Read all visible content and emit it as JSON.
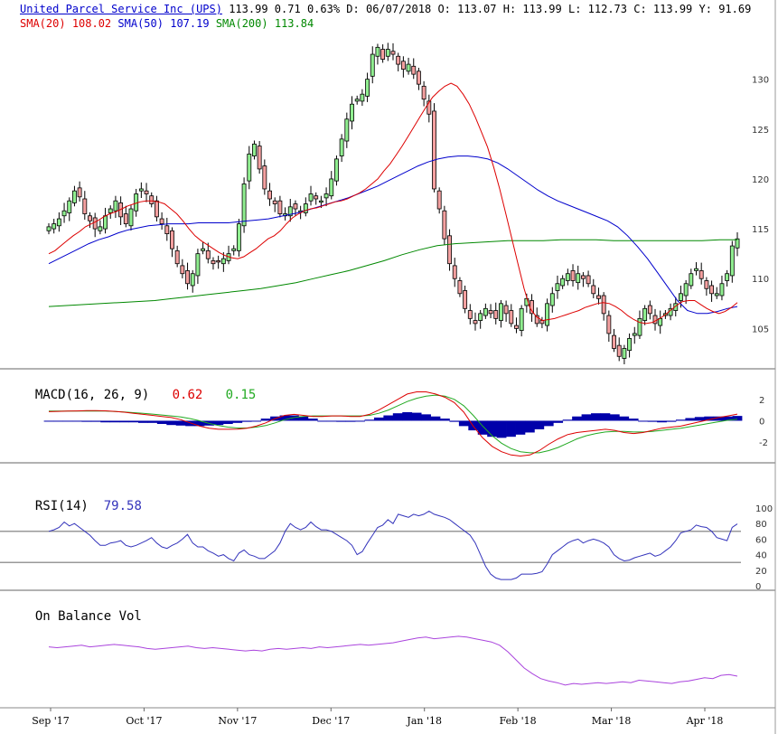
{
  "header": {
    "ticker_title": "United Parcel Service Inc (UPS)",
    "last": "113.99",
    "change": "0.71",
    "change_pct": "0.63%",
    "date_label": "D: 06/07/2018",
    "open_label": "O: 113.07",
    "high_label": "H: 113.99",
    "low_label": "L: 112.73",
    "close_label": "C: 113.99",
    "y_label": "Y:",
    "y_value": "91.69",
    "sma20_label": "SMA(20)",
    "sma20_value": "108.02",
    "sma50_label": "SMA(50)",
    "sma50_value": "107.19",
    "sma200_label": "SMA(200)",
    "sma200_value": "113.84"
  },
  "colors": {
    "sma20": "#dd0000",
    "sma50": "#0000cc",
    "sma200": "#008800",
    "up_candle": "#90ee90",
    "down_candle": "#f4a0a0",
    "macd_hist": "#0000aa",
    "rsi_line": "#3333bb",
    "obv_line": "#aa44dd"
  },
  "panels": {
    "macd": {
      "title": "MACD(16, 26, 9)",
      "macd_value": "0.62",
      "signal_value": "0.15"
    },
    "rsi": {
      "title": "RSI(14)",
      "value": "79.58"
    },
    "obv": {
      "title": "On Balance Vol"
    }
  },
  "chart_data": [
    {
      "type": "candlestick",
      "x_labels": [
        "Sep '17",
        "Oct '17",
        "Nov '17",
        "Dec '17",
        "Jan '18",
        "Feb '18",
        "Mar '18",
        "Apr '18"
      ],
      "y_ticks": [
        105,
        110,
        115,
        120,
        125,
        130
      ],
      "ylim": [
        101.5,
        134.5
      ],
      "close_path": [
        115.2,
        115.5,
        116.0,
        116.8,
        117.8,
        118.8,
        118.2,
        116.5,
        115.8,
        115.0,
        115.2,
        116.3,
        117.0,
        117.8,
        116.2,
        115.5,
        117.0,
        118.5,
        119.0,
        118.5,
        117.5,
        116.2,
        115.5,
        114.5,
        113.0,
        111.5,
        110.5,
        109.5,
        110.5,
        112.5,
        113.0,
        112.0,
        111.5,
        111.7,
        112.0,
        112.5,
        113.0,
        115.5,
        119.5,
        122.5,
        123.5,
        121.0,
        119.0,
        118.0,
        117.5,
        116.5,
        116.5,
        117.2,
        117.0,
        116.8,
        117.5,
        118.5,
        118.0,
        117.8,
        118.5,
        120.0,
        122.0,
        124.0,
        126.0,
        127.5,
        128.0,
        128.5,
        130.0,
        132.5,
        133.2,
        132.0,
        133.0,
        132.5,
        131.5,
        131.0,
        131.5,
        130.5,
        129.5,
        128.0,
        126.5,
        119.0,
        117.0,
        114.0,
        111.5,
        110.0,
        108.5,
        107.0,
        106.0,
        105.5,
        106.5,
        107.0,
        106.5,
        106.0,
        107.5,
        106.5,
        105.5,
        105.0,
        107.0,
        108.0,
        106.5,
        105.5,
        105.5,
        107.5,
        108.5,
        109.5,
        110.0,
        110.5,
        109.8,
        110.5,
        110.0,
        109.5,
        108.5,
        108.0,
        106.5,
        104.5,
        103.0,
        102.2,
        103.0,
        104.0,
        104.5,
        106.0,
        107.0,
        106.5,
        105.5,
        106.0,
        106.5,
        107.0,
        107.5,
        108.5,
        109.5,
        110.5,
        111.0,
        110.0,
        109.0,
        108.5,
        108.5,
        109.5,
        110.5,
        113.28,
        113.99
      ],
      "sma20_path": [
        112.5,
        112.8,
        113.3,
        113.8,
        114.3,
        114.7,
        115.2,
        115.5,
        115.8,
        116.2,
        116.5,
        116.7,
        117.0,
        117.3,
        117.5,
        117.7,
        117.8,
        117.8,
        117.7,
        117.5,
        117.0,
        116.5,
        115.8,
        115.0,
        114.3,
        113.8,
        113.4,
        113.0,
        112.6,
        112.3,
        112.1,
        112.0,
        112.2,
        112.6,
        113.0,
        113.5,
        114.0,
        114.3,
        114.8,
        115.5,
        116.1,
        116.5,
        116.8,
        117.0,
        117.1,
        117.3,
        117.5,
        117.7,
        117.8,
        118.0,
        118.3,
        118.6,
        119.0,
        119.5,
        120.0,
        120.8,
        121.5,
        122.4,
        123.3,
        124.3,
        125.3,
        126.3,
        127.3,
        128.2,
        128.8,
        129.3,
        129.6,
        129.3,
        128.5,
        127.5,
        126.2,
        124.7,
        123.2,
        121.2,
        119.0,
        116.5,
        114.0,
        111.5,
        109.0,
        107.0,
        106.2,
        105.8,
        105.9,
        106.0,
        106.2,
        106.4,
        106.6,
        106.8,
        107.1,
        107.3,
        107.5,
        107.6,
        107.5,
        107.2,
        106.8,
        106.3,
        105.9,
        105.6,
        105.5,
        105.6,
        105.9,
        106.3,
        106.8,
        107.3,
        107.7,
        107.8,
        107.8,
        107.4,
        107.0,
        106.7,
        106.5,
        106.7,
        107.1,
        107.6
      ],
      "sma50_path": [
        111.5,
        112.0,
        112.5,
        113.0,
        113.5,
        113.9,
        114.2,
        114.6,
        114.9,
        115.1,
        115.3,
        115.4,
        115.5,
        115.5,
        115.5,
        115.6,
        115.6,
        115.6,
        115.6,
        115.7,
        115.8,
        115.9,
        116.0,
        116.2,
        116.4,
        116.6,
        116.9,
        117.2,
        117.5,
        117.8,
        118.1,
        118.5,
        118.9,
        119.3,
        119.8,
        120.3,
        120.8,
        121.3,
        121.7,
        122.0,
        122.2,
        122.3,
        122.3,
        122.2,
        122.0,
        121.6,
        121.0,
        120.3,
        119.6,
        118.9,
        118.3,
        117.8,
        117.4,
        117.0,
        116.6,
        116.2,
        115.8,
        115.2,
        114.3,
        113.2,
        112.0,
        110.6,
        109.2,
        107.8,
        106.8,
        106.5,
        106.5,
        106.7,
        107.0,
        107.2
      ],
      "sma200_path": [
        107.2,
        107.3,
        107.4,
        107.5,
        107.6,
        107.7,
        107.8,
        108.0,
        108.2,
        108.4,
        108.6,
        108.8,
        109.0,
        109.3,
        109.6,
        110.0,
        110.4,
        110.8,
        111.3,
        111.8,
        112.4,
        112.9,
        113.3,
        113.5,
        113.6,
        113.7,
        113.8,
        113.8,
        113.8,
        113.9,
        113.9,
        113.9,
        113.8,
        113.8,
        113.8,
        113.8,
        113.8,
        113.8,
        113.9,
        113.9
      ]
    },
    {
      "type": "line",
      "title": "MACD(16, 26, 9)",
      "y_ticks": [
        2,
        0,
        -2
      ],
      "ylim": [
        -3.6,
        3.0
      ],
      "macd": [
        0.85,
        0.88,
        0.9,
        0.92,
        0.95,
        0.95,
        0.93,
        0.88,
        0.8,
        0.7,
        0.6,
        0.5,
        0.4,
        0.3,
        0.1,
        -0.2,
        -0.5,
        -0.7,
        -0.8,
        -0.8,
        -0.78,
        -0.7,
        -0.5,
        -0.2,
        0.2,
        0.5,
        0.6,
        0.5,
        0.4,
        0.4,
        0.45,
        0.45,
        0.4,
        0.4,
        0.6,
        1.0,
        1.5,
        2.0,
        2.5,
        2.7,
        2.7,
        2.5,
        2.2,
        1.7,
        0.8,
        -0.5,
        -1.6,
        -2.4,
        -2.9,
        -3.2,
        -3.3,
        -3.2,
        -2.8,
        -2.2,
        -1.7,
        -1.3,
        -1.1,
        -1.0,
        -0.9,
        -0.8,
        -0.9,
        -1.1,
        -1.2,
        -1.1,
        -0.9,
        -0.7,
        -0.6,
        -0.5,
        -0.3,
        -0.1,
        0.1,
        0.3,
        0.45,
        0.62
      ],
      "signal": [
        0.9,
        0.9,
        0.9,
        0.9,
        0.9,
        0.9,
        0.9,
        0.87,
        0.82,
        0.76,
        0.7,
        0.62,
        0.54,
        0.45,
        0.35,
        0.2,
        0.0,
        -0.25,
        -0.45,
        -0.6,
        -0.68,
        -0.68,
        -0.6,
        -0.45,
        -0.2,
        0.1,
        0.3,
        0.4,
        0.45,
        0.45,
        0.45,
        0.45,
        0.45,
        0.45,
        0.5,
        0.7,
        1.0,
        1.4,
        1.8,
        2.1,
        2.3,
        2.4,
        2.3,
        2.0,
        1.4,
        0.5,
        -0.5,
        -1.4,
        -2.1,
        -2.6,
        -2.9,
        -3.0,
        -3.0,
        -2.8,
        -2.5,
        -2.1,
        -1.7,
        -1.4,
        -1.2,
        -1.05,
        -1.0,
        -1.0,
        -1.05,
        -1.05,
        -1.0,
        -0.9,
        -0.8,
        -0.7,
        -0.55,
        -0.4,
        -0.25,
        -0.1,
        0.05,
        0.15
      ],
      "histogram": [
        0.0,
        0.0,
        0.0,
        0.0,
        -0.1,
        -0.1,
        -0.15,
        -0.15,
        -0.15,
        -0.15,
        -0.2,
        -0.2,
        -0.3,
        -0.4,
        -0.45,
        -0.5,
        -0.5,
        -0.45,
        -0.4,
        -0.3,
        -0.2,
        -0.1,
        0.0,
        0.2,
        0.4,
        0.5,
        0.5,
        0.4,
        0.2,
        0.0,
        -0.05,
        -0.1,
        -0.1,
        0.0,
        0.1,
        0.3,
        0.5,
        0.7,
        0.8,
        0.75,
        0.6,
        0.4,
        0.2,
        -0.1,
        -0.5,
        -0.9,
        -1.3,
        -1.5,
        -1.6,
        -1.5,
        -1.3,
        -1.1,
        -0.8,
        -0.5,
        -0.2,
        0.1,
        0.4,
        0.6,
        0.7,
        0.7,
        0.6,
        0.4,
        0.2,
        0.0,
        -0.1,
        -0.15,
        -0.1,
        0.1,
        0.25,
        0.35,
        0.4,
        0.4,
        0.4,
        0.45
      ]
    },
    {
      "type": "line",
      "title": "RSI(14)",
      "y_ticks": [
        100,
        80,
        60,
        40,
        20,
        0
      ],
      "ylim": [
        0,
        100
      ],
      "reference_lines": [
        70,
        30
      ],
      "values": [
        70,
        72,
        75,
        82,
        77,
        80,
        75,
        70,
        65,
        58,
        52,
        52,
        55,
        56,
        58,
        52,
        50,
        52,
        55,
        58,
        62,
        55,
        50,
        48,
        52,
        55,
        60,
        66,
        55,
        50,
        50,
        45,
        42,
        38,
        40,
        35,
        32,
        42,
        46,
        40,
        38,
        35,
        35,
        40,
        45,
        55,
        70,
        80,
        75,
        72,
        75,
        82,
        76,
        72,
        72,
        70,
        66,
        62,
        58,
        52,
        40,
        44,
        55,
        65,
        75,
        78,
        85,
        80,
        92,
        90,
        88,
        92,
        90,
        92,
        96,
        92,
        90,
        88,
        85,
        80,
        75,
        70,
        65,
        55,
        40,
        25,
        15,
        10,
        8,
        8,
        8,
        10,
        15,
        15,
        15,
        16,
        18,
        28,
        40,
        45,
        50,
        55,
        58,
        60,
        55,
        58,
        60,
        58,
        55,
        50,
        40,
        35,
        32,
        33,
        36,
        38,
        40,
        42,
        38,
        40,
        45,
        50,
        58,
        68,
        70,
        72,
        78,
        76,
        75,
        70,
        62,
        60,
        58,
        75,
        79.58
      ]
    },
    {
      "type": "line",
      "title": "On Balance Vol",
      "values": [
        66,
        65,
        66,
        67,
        68,
        66,
        67,
        68,
        69,
        68,
        67,
        66,
        64,
        63,
        64,
        65,
        66,
        67,
        65,
        64,
        65,
        64,
        63,
        62,
        61,
        62,
        61,
        63,
        64,
        63,
        64,
        65,
        64,
        66,
        65,
        66,
        67,
        68,
        69,
        68,
        69,
        70,
        71,
        73,
        75,
        77,
        78,
        76,
        77,
        78,
        79,
        78,
        76,
        74,
        72,
        68,
        60,
        50,
        40,
        33,
        27,
        24,
        22,
        19,
        21,
        20,
        21,
        22,
        21,
        22,
        23,
        22,
        25,
        24,
        23,
        22,
        21,
        23,
        24,
        26,
        28,
        27,
        31,
        32,
        30
      ]
    }
  ]
}
